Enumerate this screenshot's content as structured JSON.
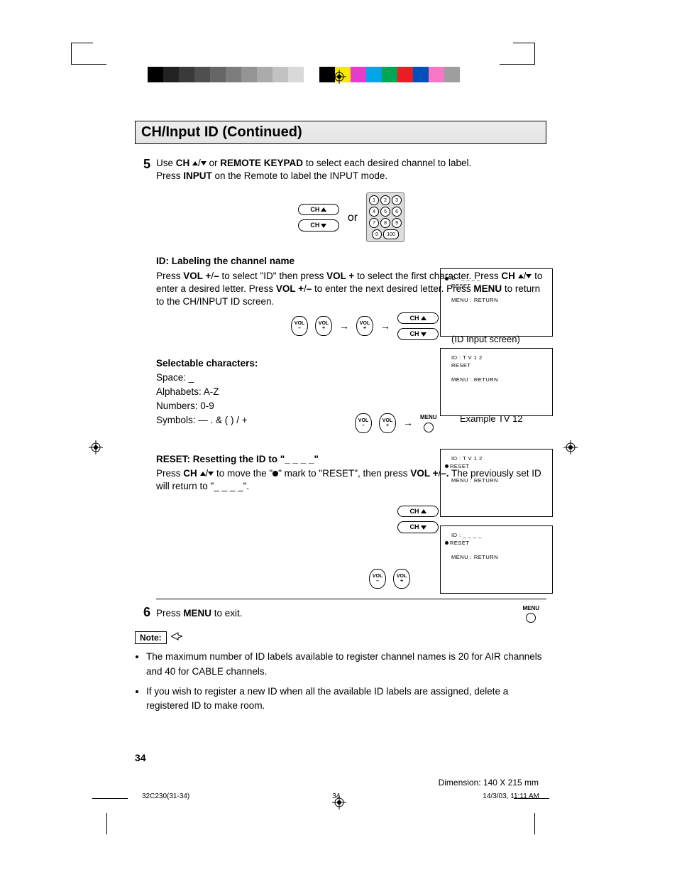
{
  "header": {
    "title": "CH/Input ID (Continued)"
  },
  "colorbar": [
    "#000",
    "#222",
    "#3a3a3a",
    "#4f4f4f",
    "#666",
    "#7d7d7d",
    "#949494",
    "#ababab",
    "#c2c2c2",
    "#d9d9d9",
    "#fff",
    "#000",
    "#f7ea00",
    "#e63ccd",
    "#00a6e6",
    "#00a651",
    "#ed1c24",
    "#0051ba",
    "#f777c6",
    "#9e9e9e"
  ],
  "step5": {
    "num": "5",
    "line1a": "Use ",
    "line1b": "CH ",
    "line1c": " or ",
    "line1d": "REMOTE KEYPAD",
    "line1e": " to select each desired channel to label.",
    "line2a": "Press ",
    "line2b": "INPUT",
    "line2c": " on the Remote to label the INPUT mode."
  },
  "or": "or",
  "keypad": {
    "keys": [
      [
        "1",
        "2",
        "3"
      ],
      [
        "4",
        "5",
        "6"
      ],
      [
        "7",
        "8",
        "9"
      ],
      [
        "0",
        "100"
      ]
    ]
  },
  "id_section": {
    "heading": "ID: Labeling the channel name",
    "p1": "Press ",
    "p1b": "VOL +",
    "p1c": "/",
    "p1d": "–",
    "p1e": " to select \"ID\" then press  ",
    "p1f": "VOL +",
    "p1g": " to select the first character. Press ",
    "p1h": "CH ",
    "p1i": " to enter a desired letter. Press ",
    "p1j": "VOL +",
    "p1k": "/",
    "p1l": "–",
    "p1m": " to enter the next desired letter. Press ",
    "p1n": "MENU",
    "p1o": " to return to the CH/INPUT ID screen."
  },
  "selectable": {
    "heading": "Selectable characters:",
    "l1": "Space: _",
    "l2": "Alphabets: A-Z",
    "l3": "Numbers: 0-9",
    "l4": "Symbols: —  .  &  (  )  /  +"
  },
  "reset": {
    "heading": "RESET: Resetting the ID to \"_ _ _ _\"",
    "p1a": "Press ",
    "p1b": "CH ",
    "p1c": " to move the \"",
    "p1d": "\" mark to \"RESET\", then press ",
    "p1e": "VOL +",
    "p1f": "/",
    "p1g": "–.",
    "p1h": " The previously set ID will return to \"_ _ _ _\"."
  },
  "step6": {
    "num": "6",
    "a": "Press ",
    "b": "MENU",
    "c": " to exit."
  },
  "vol_label": "VOL",
  "menu_label": "MENU",
  "ch_up": "CH",
  "ch_dn": "CH",
  "screens": {
    "s1": {
      "l1": "ID   : _ _ _ _",
      "l2": "RESET",
      "l3": "MENU : RETURN"
    },
    "s1_cap": "(ID Input screen)",
    "s2": {
      "l1": "ID   : T V 1 2",
      "l2": "RESET",
      "l3": "MENU : RETURN"
    },
    "s2_cap": "Example TV 12",
    "s3": {
      "l1": "ID   : T V 1 2",
      "l2": "RESET",
      "l3": "MENU : RETURN"
    },
    "s4": {
      "l1": "ID   : _ _ _ _",
      "l2": "RESET",
      "l3": "MENU : RETURN"
    }
  },
  "note_label": "Note:",
  "notes": [
    "The maximum number of ID labels available to register channel names is 20 for AIR channels and 40 for CABLE channels.",
    "If you wish to register a new ID when all the available ID labels are assigned, delete a registered ID to make room."
  ],
  "page_number": "34",
  "footer": {
    "left": "32C230(31-34)",
    "center": "34",
    "right": "14/3/03, 11:11 AM"
  },
  "dimension": "Dimension: 140  X 215 mm"
}
